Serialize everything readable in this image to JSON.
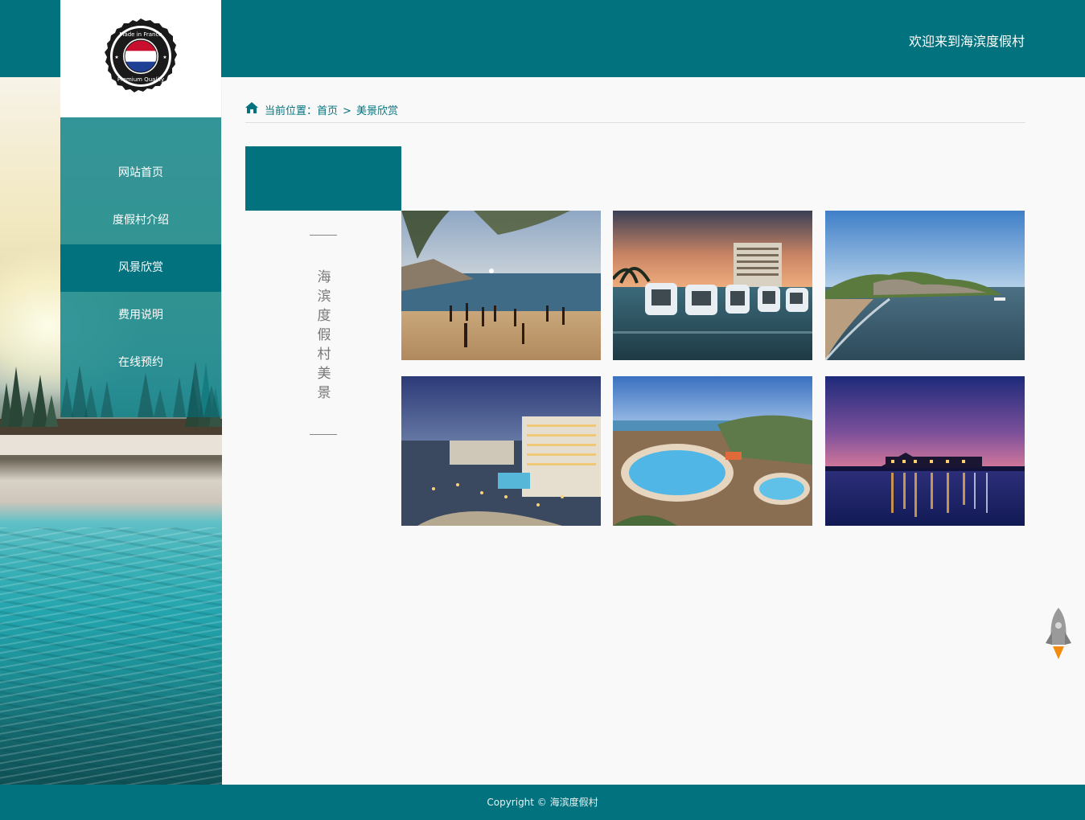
{
  "header": {
    "welcome": "欢迎来到海滨度假村",
    "logo_text": "Made in France · Premium Quality"
  },
  "nav": {
    "items": [
      {
        "label": "网站首页"
      },
      {
        "label": "度假村介绍"
      },
      {
        "label": "风景欣赏",
        "active": true
      },
      {
        "label": "费用说明"
      },
      {
        "label": "在线预约"
      }
    ]
  },
  "breadcrumb": {
    "prefix": "当前位置：",
    "home": "首页",
    "separator": ">",
    "current": "美景欣赏"
  },
  "section": {
    "title_chars": [
      "海",
      "滨",
      "度",
      "假",
      "村",
      "美",
      "景"
    ]
  },
  "gallery": {
    "photos": [
      {
        "subject": "beach-volleyball"
      },
      {
        "subject": "overwater-villas-sunset"
      },
      {
        "subject": "rocky-coastline"
      },
      {
        "subject": "resort-pool-night"
      },
      {
        "subject": "resort-pool-day"
      },
      {
        "subject": "lakeside-lodge-night"
      }
    ]
  },
  "footer": {
    "text": "Copyright © 海滨度假村"
  },
  "colors": {
    "brand_teal": "#02727e",
    "nav_teal": "#12858c",
    "rocket_flame": "#f28c10"
  },
  "icons": {
    "home": "home-icon",
    "back_to_top": "rocket-icon"
  }
}
